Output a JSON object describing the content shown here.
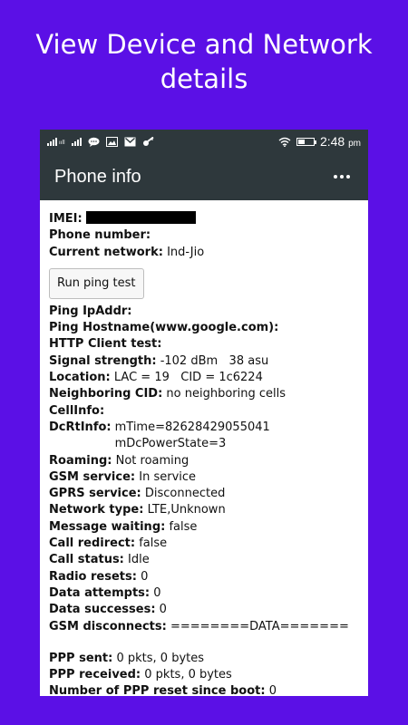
{
  "promo": {
    "line1": "View Device and Network",
    "line2": "details"
  },
  "statusbar": {
    "time": "2:48",
    "ampm": "pm"
  },
  "appbar": {
    "title": "Phone info"
  },
  "info": {
    "imei_label": "IMEI:",
    "phone_number_label": "Phone number:",
    "current_network_label": "Current network:",
    "current_network_value": "Ind-Jio",
    "ping_button": "Run ping test",
    "ping_ipaddr_label": "Ping IpAddr:",
    "ping_hostname_label": "Ping Hostname(www.google.com):",
    "http_client_label": "HTTP Client test:",
    "signal_label": "Signal strength:",
    "signal_value": "-102 dBm   38 asu",
    "location_label": "Location:",
    "location_value": "LAC = 19   CID = 1c6224",
    "neighboring_label": "Neighboring CID:",
    "neighboring_value": "no neighboring cells",
    "cellinfo_label": "CellInfo:",
    "dcrt_label": "DcRtInfo:",
    "dcrt_line1": "mTime=82628429055041",
    "dcrt_line2": "mDcPowerState=3",
    "roaming_label": "Roaming:",
    "roaming_value": "Not roaming",
    "gsm_service_label": "GSM service:",
    "gsm_service_value": "In service",
    "gprs_service_label": "GPRS service:",
    "gprs_service_value": "Disconnected",
    "network_type_label": "Network type:",
    "network_type_value": "LTE,Unknown",
    "message_waiting_label": "Message waiting:",
    "message_waiting_value": "false",
    "call_redirect_label": "Call redirect:",
    "call_redirect_value": "false",
    "call_status_label": "Call status:",
    "call_status_value": "Idle",
    "radio_resets_label": "Radio resets:",
    "radio_resets_value": "0",
    "data_attempts_label": "Data attempts:",
    "data_attempts_value": "0",
    "data_successes_label": "Data successes:",
    "data_successes_value": "0",
    "gsm_disconnects_label": "GSM disconnects:",
    "gsm_disconnects_value": "========DATA=======",
    "ppp_sent_label": "PPP sent:",
    "ppp_sent_value": "0 pkts, 0 bytes",
    "ppp_received_label": "PPP received:",
    "ppp_received_value": "0 pkts, 0 bytes",
    "ppp_reset_label": "Number of PPP reset since boot:",
    "ppp_reset_value": "0"
  },
  "colors": {
    "background": "#5b10e6",
    "appbar": "#2e383c",
    "redaction": "#000000"
  },
  "icons": [
    "signal-icon",
    "message-icon",
    "image-icon",
    "gmail-icon",
    "vpn-key-icon",
    "wifi-icon",
    "battery-icon",
    "overflow-menu-icon"
  ]
}
